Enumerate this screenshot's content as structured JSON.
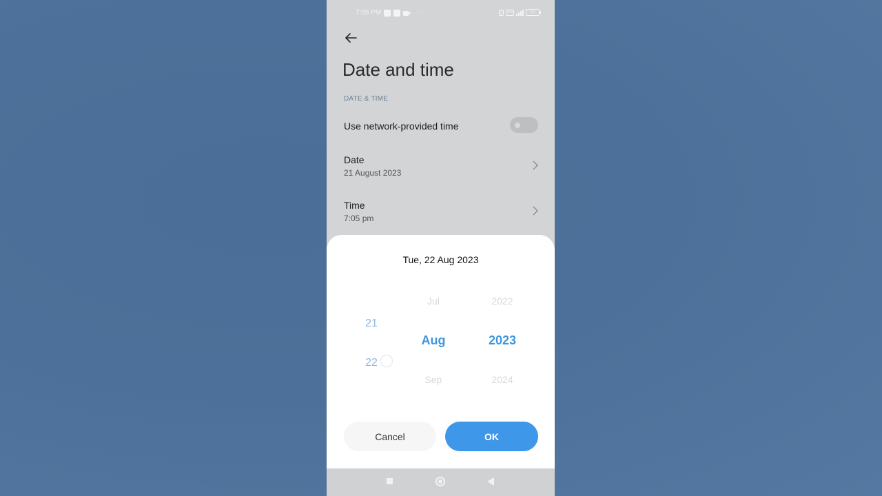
{
  "status_bar": {
    "time": "7:05 PM",
    "network_tag": "4G",
    "battery": "62"
  },
  "header": {
    "title": "Date and time",
    "back_icon": "arrow-left-icon"
  },
  "section": {
    "label": "DATE & TIME"
  },
  "settings": {
    "network_time": {
      "label": "Use network-provided time",
      "enabled": false
    },
    "date": {
      "label": "Date",
      "value": "21 August 2023"
    },
    "time": {
      "label": "Time",
      "value": "7:05 pm"
    }
  },
  "dialog": {
    "title": "Tue, 22 Aug 2023",
    "day_column": {
      "items": [
        "21",
        "22"
      ],
      "selected": "22"
    },
    "month_column": {
      "items": [
        "Jul",
        "Aug",
        "Sep"
      ],
      "selected": "Aug"
    },
    "year_column": {
      "items": [
        "2022",
        "2023",
        "2024"
      ],
      "selected": "2023"
    },
    "cancel_label": "Cancel",
    "ok_label": "OK"
  },
  "colors": {
    "accent": "#3e97e8",
    "selected_text": "#3e97de",
    "screen_bg": "#d2d4d5",
    "outer_bg": "#4c7099"
  },
  "nav_bar": {
    "icons": [
      "recents-square-icon",
      "home-circle-icon",
      "back-triangle-icon"
    ]
  }
}
